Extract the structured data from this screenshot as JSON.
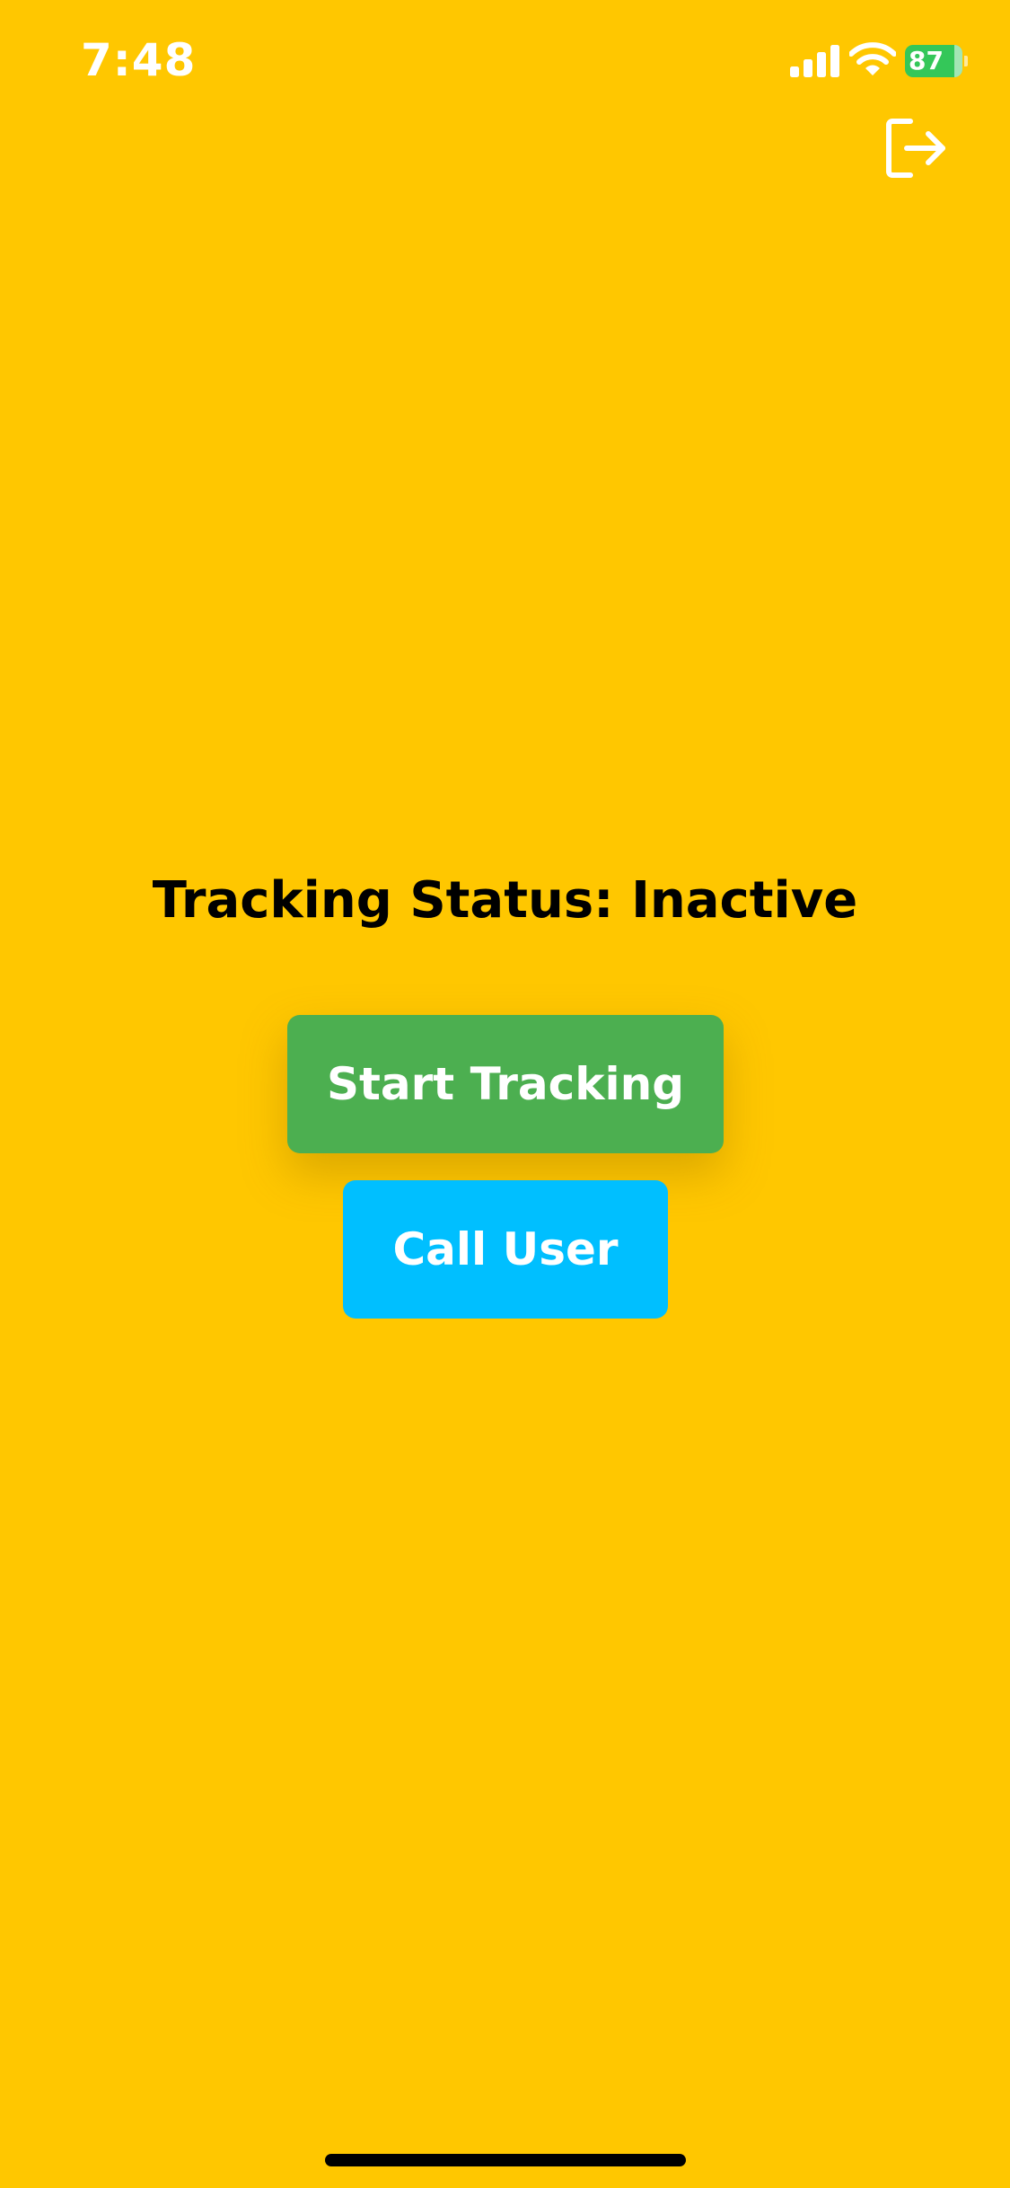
{
  "status_bar": {
    "time": "7:48",
    "battery_level": "87",
    "battery_state": "charging",
    "battery_color": "#34C759",
    "icons": [
      "signal-icon",
      "wifi-icon",
      "battery-icon",
      "charging-bolt-icon"
    ]
  },
  "header": {
    "logout_icon": "logout-icon"
  },
  "main": {
    "status_text": "Tracking Status: Inactive",
    "start_button_label": "Start Tracking",
    "call_button_label": "Call User"
  },
  "colors": {
    "background": "#FFC700",
    "start_button": "#4CAF50",
    "call_button": "#00BFFF",
    "text_primary": "#000000",
    "button_text": "#FFFFFF"
  }
}
